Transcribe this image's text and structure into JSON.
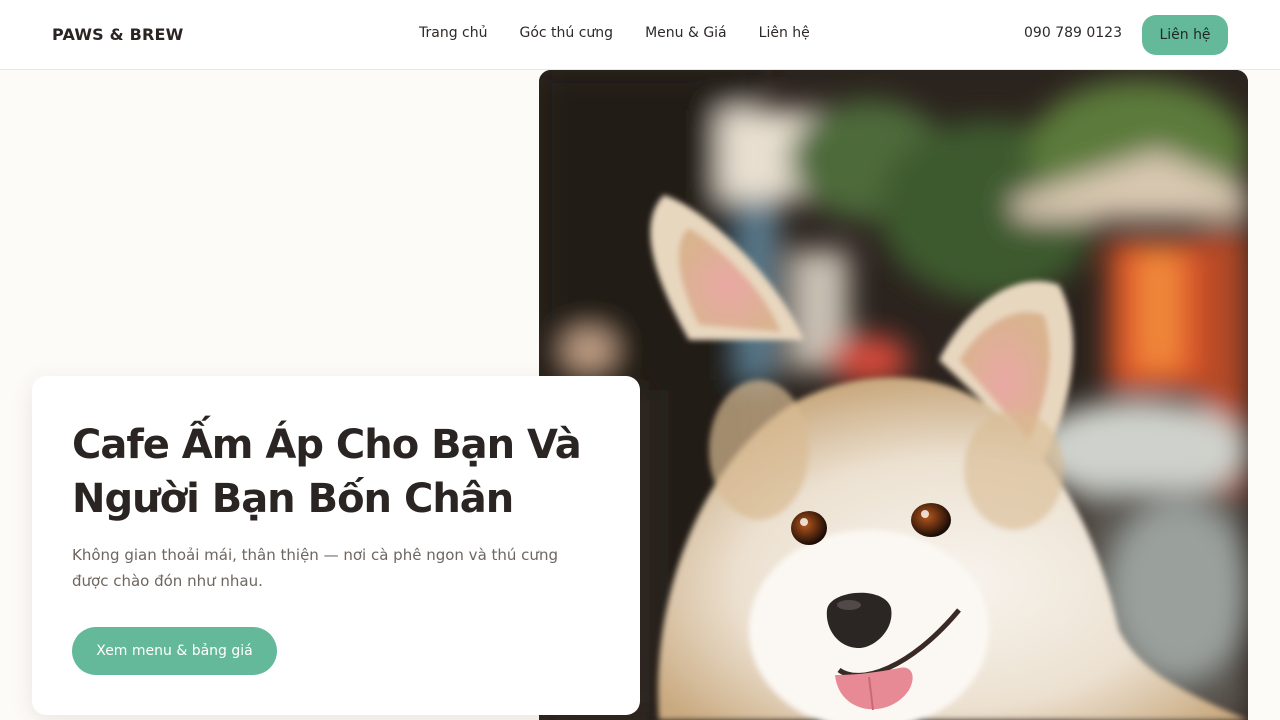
{
  "brand": {
    "logo_text": "PAWS & BREW"
  },
  "nav": {
    "items": [
      {
        "label": "Trang chủ"
      },
      {
        "label": "Góc thú cưng"
      },
      {
        "label": "Menu & Giá"
      },
      {
        "label": "Liên hệ"
      }
    ]
  },
  "header": {
    "phone": "090 789 0123",
    "contact_button": "Liên hệ"
  },
  "hero": {
    "title": "Cafe Ấm Áp Cho Bạn Và Người Bạn Bốn Chân",
    "description": "Không gian thoải mái, thân thiện — nơi cà phê ngon và thú cưng được chào đón như nhau.",
    "cta_button": "Xem menu & bảng giá",
    "image_subject": "corgi-dog-photo"
  },
  "colors": {
    "accent": "#63b99a",
    "text_dark": "#2a2522",
    "text_muted": "#6e6660",
    "page_background": "#fdfbf8"
  }
}
